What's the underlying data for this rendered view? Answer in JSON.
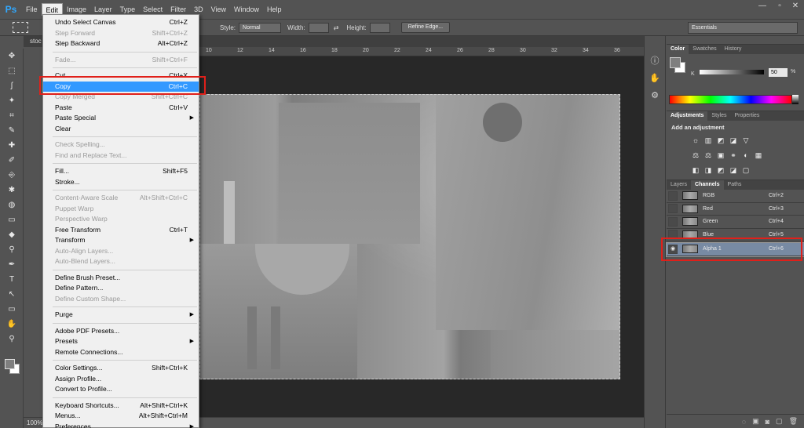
{
  "app": {
    "logo": "Ps"
  },
  "menubar": {
    "items": [
      "File",
      "Edit",
      "Image",
      "Layer",
      "Type",
      "Select",
      "Filter",
      "3D",
      "View",
      "Window",
      "Help"
    ],
    "active": "Edit"
  },
  "window_controls": {
    "minimize": "—",
    "maximize": "▫",
    "close": "✕"
  },
  "options": {
    "style_label": "Style:",
    "style_value": "Normal",
    "width_label": "Width:",
    "height_label": "Height:",
    "refine_edge": "Refine Edge...",
    "workspace": "Essentials"
  },
  "document": {
    "tab_title": "stoc",
    "zoom": "100%",
    "ruler_numbers": [
      "10",
      "12",
      "14",
      "16",
      "18",
      "20",
      "22",
      "24",
      "26",
      "28",
      "30",
      "32",
      "34",
      "36"
    ]
  },
  "edit_menu": {
    "items": [
      {
        "label": "Undo Select Canvas",
        "shortcut": "Ctrl+Z",
        "disabled": false
      },
      {
        "label": "Step Forward",
        "shortcut": "Shift+Ctrl+Z",
        "disabled": true
      },
      {
        "label": "Step Backward",
        "shortcut": "Alt+Ctrl+Z",
        "disabled": false
      },
      {
        "sep": true
      },
      {
        "label": "Fade...",
        "shortcut": "Shift+Ctrl+F",
        "disabled": true
      },
      {
        "sep": true
      },
      {
        "label": "Cut",
        "shortcut": "Ctrl+X",
        "disabled": false
      },
      {
        "label": "Copy",
        "shortcut": "Ctrl+C",
        "disabled": false,
        "highlighted": true
      },
      {
        "label": "Copy Merged",
        "shortcut": "Shift+Ctrl+C",
        "disabled": true
      },
      {
        "label": "Paste",
        "shortcut": "Ctrl+V",
        "disabled": false
      },
      {
        "label": "Paste Special",
        "shortcut": "",
        "disabled": false,
        "submenu": true
      },
      {
        "label": "Clear",
        "shortcut": "",
        "disabled": false
      },
      {
        "sep": true
      },
      {
        "label": "Check Spelling...",
        "shortcut": "",
        "disabled": true
      },
      {
        "label": "Find and Replace Text...",
        "shortcut": "",
        "disabled": true
      },
      {
        "sep": true
      },
      {
        "label": "Fill...",
        "shortcut": "Shift+F5",
        "disabled": false
      },
      {
        "label": "Stroke...",
        "shortcut": "",
        "disabled": false
      },
      {
        "sep": true
      },
      {
        "label": "Content-Aware Scale",
        "shortcut": "Alt+Shift+Ctrl+C",
        "disabled": true
      },
      {
        "label": "Puppet Warp",
        "shortcut": "",
        "disabled": true
      },
      {
        "label": "Perspective Warp",
        "shortcut": "",
        "disabled": true
      },
      {
        "label": "Free Transform",
        "shortcut": "Ctrl+T",
        "disabled": false
      },
      {
        "label": "Transform",
        "shortcut": "",
        "disabled": false,
        "submenu": true
      },
      {
        "label": "Auto-Align Layers...",
        "shortcut": "",
        "disabled": true
      },
      {
        "label": "Auto-Blend Layers...",
        "shortcut": "",
        "disabled": true
      },
      {
        "sep": true
      },
      {
        "label": "Define Brush Preset...",
        "shortcut": "",
        "disabled": false
      },
      {
        "label": "Define Pattern...",
        "shortcut": "",
        "disabled": false
      },
      {
        "label": "Define Custom Shape...",
        "shortcut": "",
        "disabled": true
      },
      {
        "sep": true
      },
      {
        "label": "Purge",
        "shortcut": "",
        "disabled": false,
        "submenu": true
      },
      {
        "sep": true
      },
      {
        "label": "Adobe PDF Presets...",
        "shortcut": "",
        "disabled": false
      },
      {
        "label": "Presets",
        "shortcut": "",
        "disabled": false,
        "submenu": true
      },
      {
        "label": "Remote Connections...",
        "shortcut": "",
        "disabled": false
      },
      {
        "sep": true
      },
      {
        "label": "Color Settings...",
        "shortcut": "Shift+Ctrl+K",
        "disabled": false
      },
      {
        "label": "Assign Profile...",
        "shortcut": "",
        "disabled": false
      },
      {
        "label": "Convert to Profile...",
        "shortcut": "",
        "disabled": false
      },
      {
        "sep": true
      },
      {
        "label": "Keyboard Shortcuts...",
        "shortcut": "Alt+Shift+Ctrl+K",
        "disabled": false
      },
      {
        "label": "Menus...",
        "shortcut": "Alt+Shift+Ctrl+M",
        "disabled": false
      },
      {
        "label": "Preferences",
        "shortcut": "",
        "disabled": false,
        "submenu": true
      }
    ]
  },
  "color_panel": {
    "tabs": [
      "Color",
      "Swatches",
      "History"
    ],
    "active_tab": "Color",
    "channel_label": "K",
    "value": "50",
    "unit": "%",
    "foreground": "#7f7f7f"
  },
  "adjustments_panel": {
    "tabs": [
      "Adjustments",
      "Styles",
      "Properties"
    ],
    "active_tab": "Adjustments",
    "title": "Add an adjustment",
    "row1_icons": [
      "☼",
      "▥",
      "◩",
      "◪",
      "▽"
    ],
    "row2_icons": [
      "⚖",
      "⚖",
      "▣",
      "⚭",
      "◐",
      "▦"
    ],
    "row3_icons": [
      "◧",
      "◨",
      "◩",
      "◪",
      "▢"
    ]
  },
  "channels_panel": {
    "tabs": [
      "Layers",
      "Channels",
      "Paths"
    ],
    "active_tab": "Channels",
    "channels": [
      {
        "name": "RGB",
        "shortcut": "Ctrl+2",
        "visible": false,
        "selected": false
      },
      {
        "name": "Red",
        "shortcut": "Ctrl+3",
        "visible": false,
        "selected": false
      },
      {
        "name": "Green",
        "shortcut": "Ctrl+4",
        "visible": false,
        "selected": false
      },
      {
        "name": "Blue",
        "shortcut": "Ctrl+5",
        "visible": false,
        "selected": false
      },
      {
        "name": "Alpha 1",
        "shortcut": "Ctrl+6",
        "visible": true,
        "selected": true
      }
    ],
    "eye_glyph": "◉"
  },
  "tools": [
    "✥",
    "⬚",
    "ʃ",
    "✦",
    "⌗",
    "✎",
    "✚",
    "✐",
    "⎆",
    "✱",
    "◍",
    "▭",
    "◆",
    "⚲",
    "✒",
    "T",
    "↖",
    "▭",
    "✋",
    "⚲"
  ],
  "panel_footer_icons": [
    "◌",
    "▣",
    "◙",
    "▢",
    "🗑"
  ],
  "strip_icons": [
    "ⓘ",
    "✋",
    "⚙"
  ],
  "highlight_color": "#e0201a"
}
